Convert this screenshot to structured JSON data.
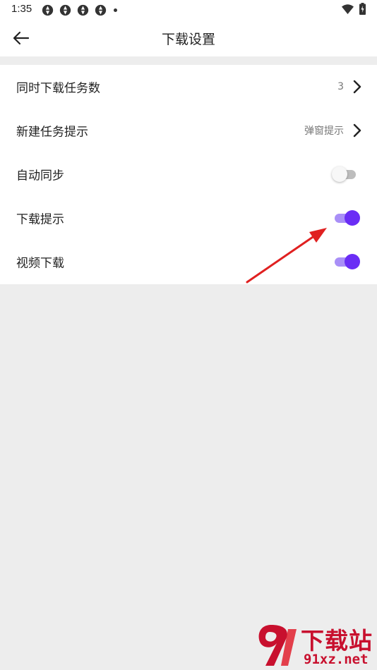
{
  "status_bar": {
    "time": "1:35",
    "icons": [
      "notification-icon",
      "notification-icon",
      "notification-icon",
      "notification-icon",
      "dot-icon",
      "wifi-icon",
      "battery-charging-icon"
    ]
  },
  "app_bar": {
    "back_icon": "arrow-left-icon",
    "title": "下载设置"
  },
  "settings": [
    {
      "label": "同时下载任务数",
      "value": "3",
      "control": "chevron"
    },
    {
      "label": "新建任务提示",
      "value": "弹窗提示",
      "control": "chevron"
    },
    {
      "label": "自动同步",
      "control": "toggle",
      "enabled": false
    },
    {
      "label": "下载提示",
      "control": "toggle",
      "enabled": true
    },
    {
      "label": "视频下载",
      "control": "toggle",
      "enabled": true
    }
  ],
  "colors": {
    "accent": "#6a2df5",
    "accent_track": "#a98ff7",
    "annotation": "#e02020",
    "watermark": "#c8102e"
  },
  "watermark": {
    "title": "下载站",
    "domain": "91xz.net"
  }
}
